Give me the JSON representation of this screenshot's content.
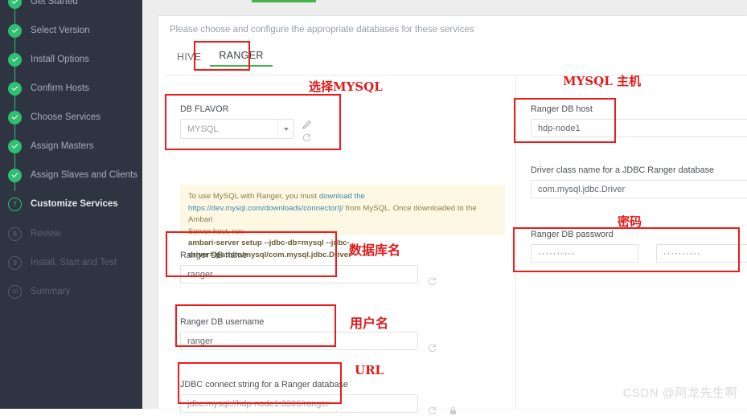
{
  "sidebar": {
    "steps": [
      {
        "num": "1",
        "label": "Get Started",
        "state": "done"
      },
      {
        "num": "2",
        "label": "Select Version",
        "state": "done"
      },
      {
        "num": "3",
        "label": "Install Options",
        "state": "done"
      },
      {
        "num": "4",
        "label": "Confirm Hosts",
        "state": "done"
      },
      {
        "num": "5",
        "label": "Choose Services",
        "state": "done"
      },
      {
        "num": "6",
        "label": "Assign Masters",
        "state": "done"
      },
      {
        "num": "7",
        "label": "Assign Slaves and Clients",
        "state": "done"
      },
      {
        "num": "7",
        "label": "Customize Services",
        "state": "current"
      },
      {
        "num": "8",
        "label": "Review",
        "state": "todo"
      },
      {
        "num": "9",
        "label": "Install, Start and Test",
        "state": "todo"
      },
      {
        "num": "10",
        "label": "Summary",
        "state": "todo"
      }
    ]
  },
  "main": {
    "intro": "Please choose and configure the appropriate databases for these services",
    "tabs": [
      {
        "label": "HIVE",
        "active": false
      },
      {
        "label": "RANGER",
        "active": true
      }
    ],
    "db_flavor": {
      "label": "DB FLAVOR",
      "value": "MYSQL",
      "edit_icon": "pencil-icon",
      "refresh_icon": "refresh-icon"
    },
    "warning": {
      "line1_a": "To use MySQL with Ranger, you must ",
      "line1_link": "download the",
      "line2_link": "https://dev.mysql.com/downloads/connector/j/",
      "line2_b": " from MySQL. Once downloaded to the Ambari",
      "line3": "Server host, run:",
      "command": "ambari-server setup --jdbc-db=mysql --jdbc-driver=/path/to/mysql/com.mysql.jdbc.Driver"
    },
    "fields_left": [
      {
        "label": "Ranger DB name",
        "value": "ranger",
        "refresh": true,
        "lock": false
      },
      {
        "label": "Ranger DB username",
        "value": "ranger",
        "refresh": true,
        "lock": false
      },
      {
        "label": "JDBC connect string for a Ranger database",
        "value": "jdbc:mysql://hdp-node1:3306/ranger",
        "refresh": true,
        "lock": true
      }
    ],
    "fields_right": [
      {
        "label": "Ranger DB host",
        "value": "hdp-node1"
      },
      {
        "label": "Driver class name for a JDBC Ranger database",
        "value": "com.mysql.jdbc.Driver"
      }
    ],
    "password_field": {
      "label": "Ranger DB password",
      "value": "··········",
      "confirm_value": "··········"
    }
  },
  "annotations": [
    {
      "text": "选择MYSQL",
      "name": "annotation-select-mysql"
    },
    {
      "text": "MYSQL 主机",
      "name": "annotation-mysql-host"
    },
    {
      "text": "数据库名",
      "name": "annotation-db-name"
    },
    {
      "text": "密码",
      "name": "annotation-password"
    },
    {
      "text": "用户名",
      "name": "annotation-username"
    },
    {
      "text": "URL",
      "name": "annotation-url"
    }
  ],
  "watermark": "CSDN @阿龙先生啊",
  "colors": {
    "accent_green": "#2fbf71",
    "tab_underline": "#4caf50",
    "annotation_red": "#ee1b1b",
    "sidebar_bg": "#2f3442"
  }
}
